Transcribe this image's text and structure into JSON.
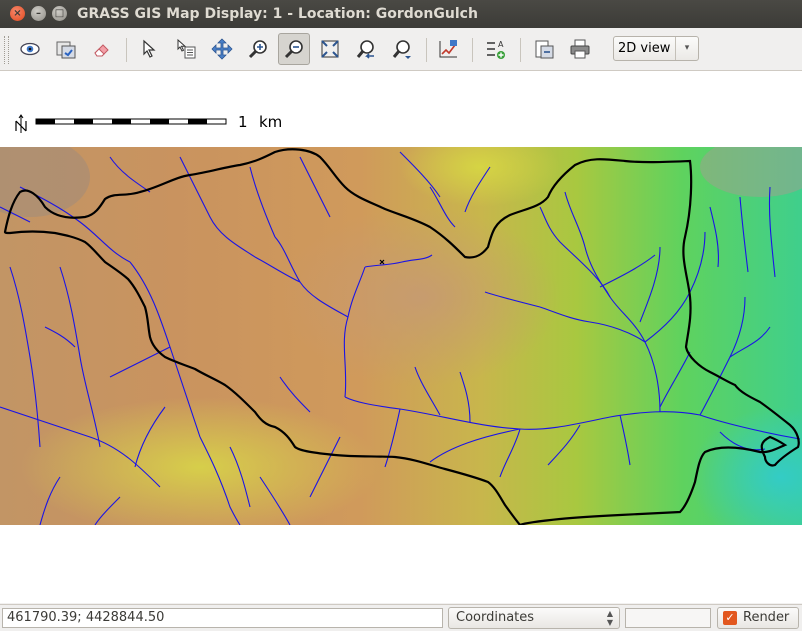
{
  "window": {
    "title": "GRASS GIS Map Display: 1  - Location: GordonGulch",
    "close_glyph": "×",
    "min_glyph": "–",
    "max_glyph": "□"
  },
  "toolbar": {
    "view_mode": "2D view",
    "dropdown_glyph": "▾",
    "tools": [
      "display-map-icon",
      "render-map-icon",
      "erase-display-icon",
      "pointer-icon",
      "query-icon",
      "pan-icon",
      "zoom-in-icon",
      "zoom-out-icon",
      "zoom-extent-icon",
      "zoom-back-icon",
      "zoom-options-icon",
      "analyze-icon",
      "overlay-icon",
      "save-icon",
      "print-icon"
    ]
  },
  "map": {
    "scalebar": {
      "value": "1",
      "unit": "km",
      "north": "N"
    }
  },
  "statusbar": {
    "coordinates": "461790.39; 4428844.50",
    "mode": "Coordinates",
    "render_label": "Render",
    "render_checked": true,
    "check_glyph": "✓"
  },
  "colors": {
    "stream": "#1a14e6",
    "boundary": "#000000",
    "accent": "#e2571e"
  }
}
